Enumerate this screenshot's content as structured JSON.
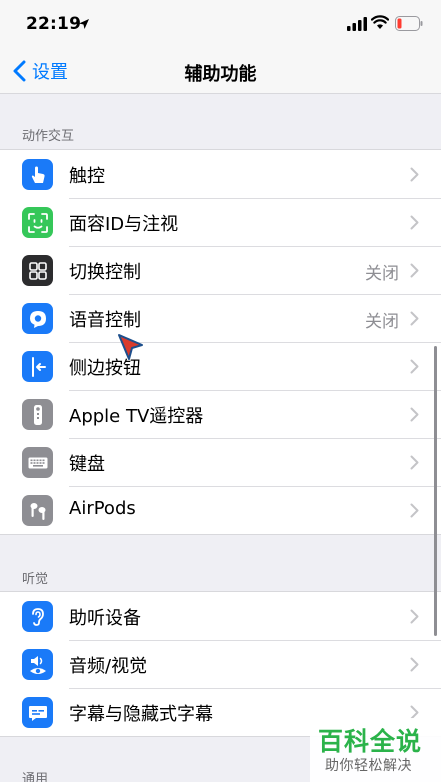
{
  "status": {
    "time": "22:19"
  },
  "nav": {
    "back_label": "设置",
    "title": "辅助功能"
  },
  "sections": [
    {
      "header": "动作交互",
      "items": [
        {
          "label": "触控",
          "value": "",
          "icon": "hand-touch-icon",
          "color": "#1a7af8"
        },
        {
          "label": "面容ID与注视",
          "value": "",
          "icon": "face-id-icon",
          "color": "#35c759"
        },
        {
          "label": "切换控制",
          "value": "关闭",
          "icon": "switch-control-icon",
          "color": "#2c2c2e"
        },
        {
          "label": "语音控制",
          "value": "关闭",
          "icon": "voice-control-icon",
          "color": "#1a7af8"
        },
        {
          "label": "侧边按钮",
          "value": "",
          "icon": "side-button-icon",
          "color": "#1a7af8"
        },
        {
          "label": "Apple TV遥控器",
          "value": "",
          "icon": "remote-icon",
          "color": "#8e8e93"
        },
        {
          "label": "键盘",
          "value": "",
          "icon": "keyboard-icon",
          "color": "#8e8e93"
        },
        {
          "label": "AirPods",
          "value": "",
          "icon": "airpods-icon",
          "color": "#8e8e93"
        }
      ]
    },
    {
      "header": "听觉",
      "items": [
        {
          "label": "助听设备",
          "value": "",
          "icon": "ear-icon",
          "color": "#1a7af8"
        },
        {
          "label": "音频/视觉",
          "value": "",
          "icon": "audio-visual-icon",
          "color": "#1a7af8"
        },
        {
          "label": "字幕与隐藏式字幕",
          "value": "",
          "icon": "subtitles-icon",
          "color": "#1a7af8"
        }
      ]
    },
    {
      "header": "通用"
    }
  ],
  "watermark": {
    "title": "百科全说",
    "subtitle": "助你轻松解决"
  }
}
